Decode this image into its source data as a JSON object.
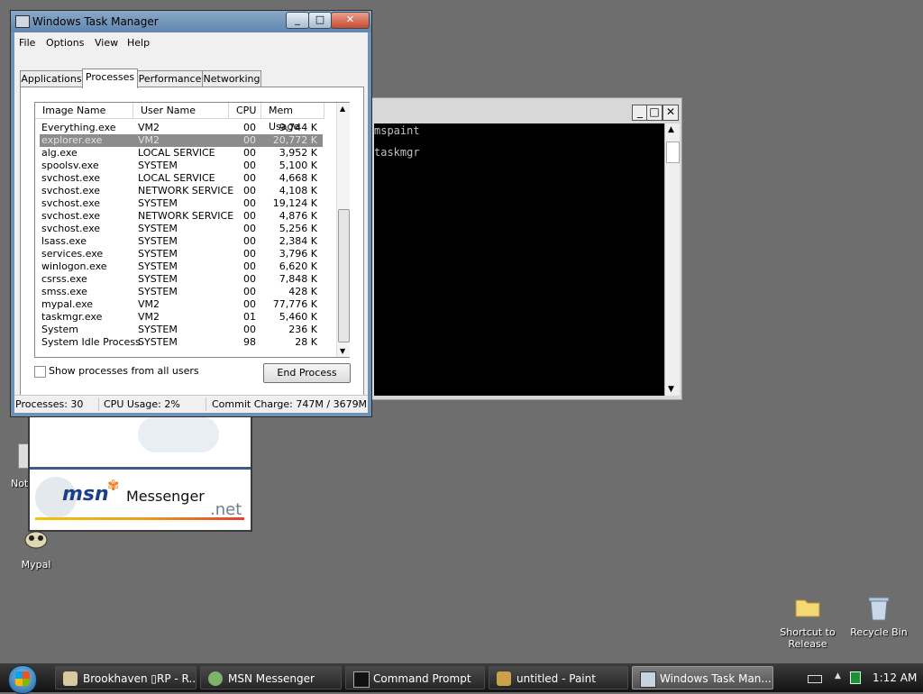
{
  "desktop": {
    "icons": [
      {
        "label": "Mypal"
      },
      {
        "label": "Shortcut to Release"
      },
      {
        "label": "Recycle Bin"
      },
      {
        "label": "Note"
      }
    ]
  },
  "command_prompt": {
    "lines": [
      "mspaint",
      "taskmgr"
    ]
  },
  "messenger": {
    "brand": "msn",
    "product": "Messenger",
    "net": ".net"
  },
  "task_manager": {
    "title": "Windows Task Manager",
    "menu": [
      "File",
      "Options",
      "View",
      "Help"
    ],
    "tabs": [
      "Applications",
      "Processes",
      "Performance",
      "Networking"
    ],
    "active_tab": "Processes",
    "columns": [
      "Image Name",
      "User Name",
      "CPU",
      "Mem Usage"
    ],
    "processes": [
      {
        "name": "Everything.exe",
        "user": "VM2",
        "cpu": "00",
        "mem": "9,744 K"
      },
      {
        "name": "explorer.exe",
        "user": "VM2",
        "cpu": "00",
        "mem": "20,772 K"
      },
      {
        "name": "alg.exe",
        "user": "LOCAL SERVICE",
        "cpu": "00",
        "mem": "3,952 K"
      },
      {
        "name": "spoolsv.exe",
        "user": "SYSTEM",
        "cpu": "00",
        "mem": "5,100 K"
      },
      {
        "name": "svchost.exe",
        "user": "LOCAL SERVICE",
        "cpu": "00",
        "mem": "4,668 K"
      },
      {
        "name": "svchost.exe",
        "user": "NETWORK SERVICE",
        "cpu": "00",
        "mem": "4,108 K"
      },
      {
        "name": "svchost.exe",
        "user": "SYSTEM",
        "cpu": "00",
        "mem": "19,124 K"
      },
      {
        "name": "svchost.exe",
        "user": "NETWORK SERVICE",
        "cpu": "00",
        "mem": "4,876 K"
      },
      {
        "name": "svchost.exe",
        "user": "SYSTEM",
        "cpu": "00",
        "mem": "5,256 K"
      },
      {
        "name": "lsass.exe",
        "user": "SYSTEM",
        "cpu": "00",
        "mem": "2,384 K"
      },
      {
        "name": "services.exe",
        "user": "SYSTEM",
        "cpu": "00",
        "mem": "3,796 K"
      },
      {
        "name": "winlogon.exe",
        "user": "SYSTEM",
        "cpu": "00",
        "mem": "6,620 K"
      },
      {
        "name": "csrss.exe",
        "user": "SYSTEM",
        "cpu": "00",
        "mem": "7,848 K"
      },
      {
        "name": "smss.exe",
        "user": "SYSTEM",
        "cpu": "00",
        "mem": "428 K"
      },
      {
        "name": "mypal.exe",
        "user": "VM2",
        "cpu": "00",
        "mem": "77,776 K"
      },
      {
        "name": "taskmgr.exe",
        "user": "VM2",
        "cpu": "01",
        "mem": "5,460 K"
      },
      {
        "name": "System",
        "user": "SYSTEM",
        "cpu": "00",
        "mem": "236 K"
      },
      {
        "name": "System Idle Process",
        "user": "SYSTEM",
        "cpu": "98",
        "mem": "28 K"
      }
    ],
    "selected_process": "explorer.exe",
    "show_all_label": "Show processes from all users",
    "show_all_checked": false,
    "end_process_label": "End Process",
    "status": {
      "processes": "Processes: 30",
      "cpu": "CPU Usage: 2%",
      "commit": "Commit Charge: 747M / 3679M"
    }
  },
  "taskbar": {
    "items": [
      {
        "label": "Brookhaven ▯RP - R...",
        "icon": "roblox-icon",
        "active": false
      },
      {
        "label": "MSN Messenger",
        "icon": "msn-icon",
        "active": false
      },
      {
        "label": "Command Prompt",
        "icon": "cmd-icon",
        "active": false
      },
      {
        "label": "untitled - Paint",
        "icon": "paint-icon",
        "active": false
      },
      {
        "label": "Windows Task Man...",
        "icon": "taskmgr-icon",
        "active": true
      }
    ],
    "clock": "1:12 AM"
  }
}
